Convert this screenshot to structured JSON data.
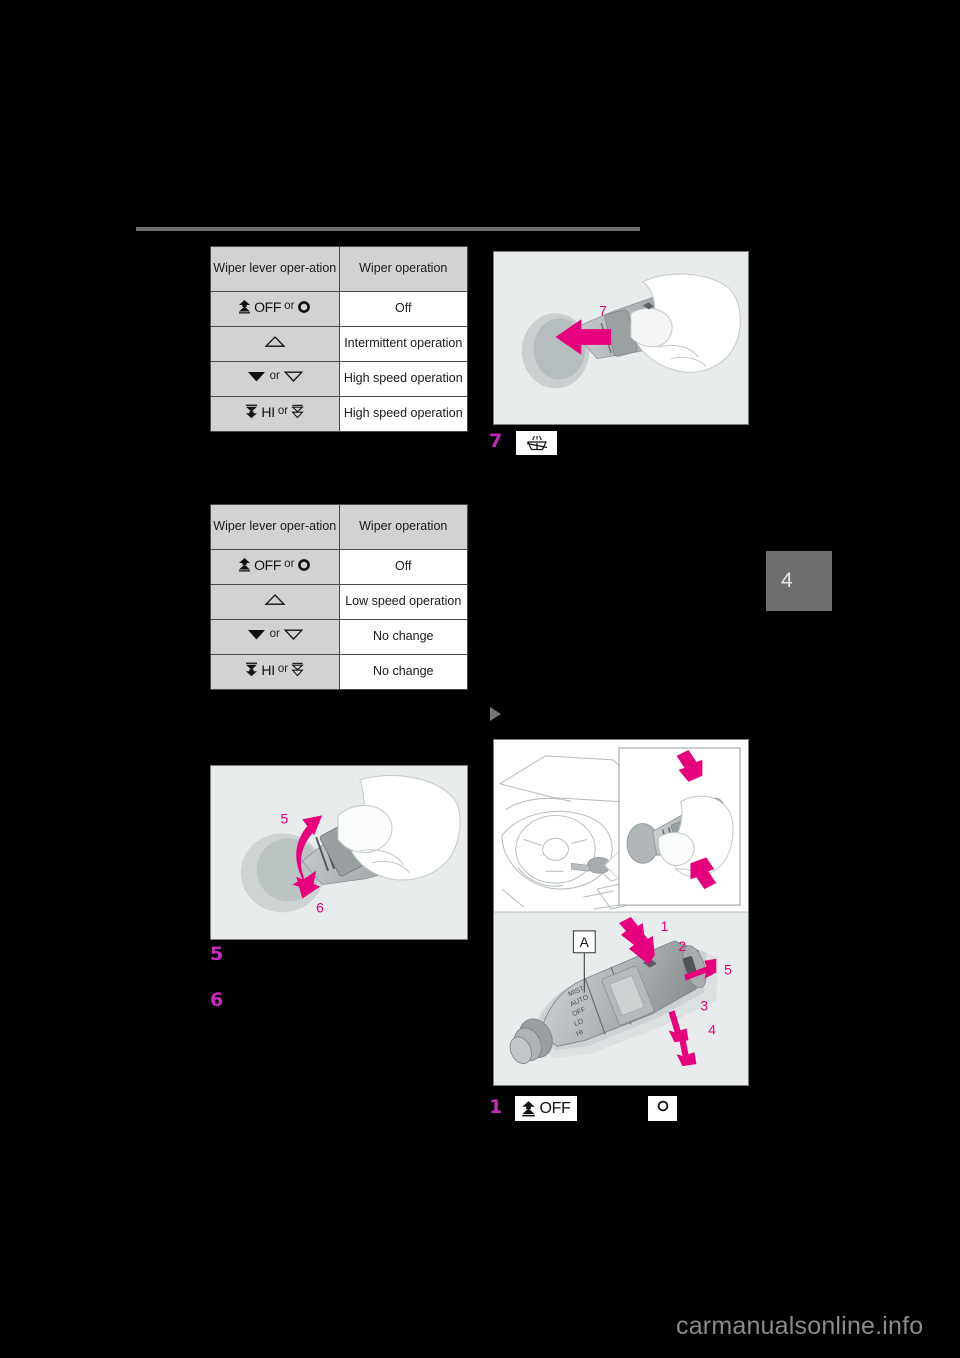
{
  "document": {
    "type": "vehicle-owners-manual-page",
    "chapter_tab": "4",
    "watermark": "carmanualsonline.info"
  },
  "tables": [
    {
      "id": "rain-sensor-table",
      "headers": [
        "Wiper lever oper-\nation",
        "Wiper operation"
      ],
      "header_lever": "Wiper lever oper-ation",
      "header_operation": "Wiper operation",
      "rows": [
        {
          "lever_text": "OFF",
          "lever_or": "or",
          "lever_icon": "wiper-off-up-chevron",
          "lever_alt_icon": "circle-o",
          "operation": "Off"
        },
        {
          "lever_text": "",
          "lever_or": "",
          "lever_icon": "triangle-up-outline",
          "lever_alt_icon": "",
          "operation": "Intermittent operation"
        },
        {
          "lever_text": "",
          "lever_or": "or",
          "lever_icon": "triangle-down-filled",
          "lever_alt_icon": "triangle-down-outline",
          "operation": "High speed operation"
        },
        {
          "lever_text": "HI",
          "lever_or": "or",
          "lever_icon": "wiper-hi-down-chevron",
          "lever_alt_icon": "wiper-down-chevron-outline",
          "operation": "High speed operation"
        }
      ]
    },
    {
      "id": "second-wiper-table",
      "header_lever": "Wiper lever oper-ation",
      "header_operation": "Wiper operation",
      "rows": [
        {
          "lever_text": "OFF",
          "lever_or": "or",
          "lever_icon": "wiper-off-up-chevron",
          "lever_alt_icon": "circle-o",
          "operation": "Off"
        },
        {
          "lever_text": "",
          "lever_or": "",
          "lever_icon": "triangle-up-outline",
          "lever_alt_icon": "",
          "operation": "Low speed operation"
        },
        {
          "lever_text": "",
          "lever_or": "or",
          "lever_icon": "triangle-down-filled",
          "lever_alt_icon": "triangle-down-outline",
          "operation": "No change"
        },
        {
          "lever_text": "HI",
          "lever_or": "or",
          "lever_icon": "wiper-hi-down-chevron",
          "lever_alt_icon": "wiper-down-chevron-outline",
          "operation": "No change"
        }
      ]
    }
  ],
  "figures": {
    "top_right": {
      "name": "hand-pulling-wiper-lever-toward-driver",
      "arrow_labels": [
        "7"
      ]
    },
    "bottom_left": {
      "name": "hand-rotating-wiper-lever-ring",
      "arrow_labels": [
        "5",
        "6"
      ]
    },
    "bottom_right": {
      "name": "steering-column-wiper-lever-overview",
      "inset_arrow_labels": [],
      "lever_callout": "A",
      "lever_arrow_labels": [
        "1",
        "2",
        "5",
        "3",
        "4"
      ]
    }
  },
  "steps": [
    {
      "number": "7",
      "icon": "windshield-washer-icon",
      "icon_label": "washer"
    },
    {
      "number": "5",
      "icon": "",
      "icon_label": ""
    },
    {
      "number": "6",
      "icon": "",
      "icon_label": ""
    },
    {
      "number": "1",
      "icon": "wiper-off-icon",
      "icon_label": "OFF",
      "icon_alt": "circle-o"
    }
  ],
  "colors": {
    "accent_magenta": "#c72bbd",
    "arrow_magenta": "#e6007e",
    "table_header_bg": "#d2d2d2",
    "figure_bg": "#e8ecec",
    "page_bg": "#000000",
    "tab_gray": "#6e6e6e"
  }
}
